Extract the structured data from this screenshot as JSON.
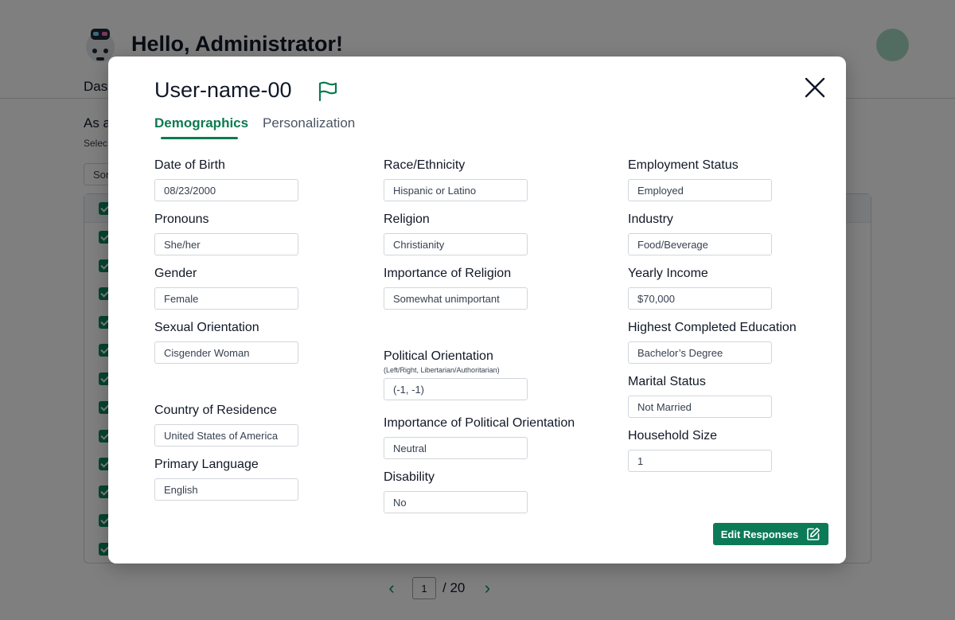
{
  "background": {
    "greeting": "Hello, Administrator!",
    "nav_label": "Dash",
    "heading": "As a",
    "subtext": "Selec",
    "sort_label": "Sor",
    "pager": {
      "current_page": "1",
      "total_label": "/ 20"
    }
  },
  "modal": {
    "title": "User-name-00",
    "tabs": [
      {
        "label": "Demographics",
        "active": true
      },
      {
        "label": "Personalization",
        "active": false
      }
    ],
    "fields": {
      "date_of_birth": {
        "label": "Date of Birth",
        "value": "08/23/2000"
      },
      "pronouns": {
        "label": "Pronouns",
        "value": "She/her"
      },
      "gender": {
        "label": "Gender",
        "value": "Female"
      },
      "sexual_orientation": {
        "label": "Sexual Orientation",
        "value": "Cisgender Woman"
      },
      "country_of_residence": {
        "label": "Country of Residence",
        "value": "United States of America"
      },
      "primary_language": {
        "label": "Primary Language",
        "value": "English"
      },
      "race_ethnicity": {
        "label": "Race/Ethnicity",
        "value": "Hispanic or Latino"
      },
      "religion": {
        "label": "Religion",
        "value": "Christianity"
      },
      "importance_of_religion": {
        "label": "Importance of Religion",
        "value": "Somewhat unimportant"
      },
      "political_orientation": {
        "label": "Political Orientation",
        "hint": "(Left/Right, Libertarian/Authoritarian)",
        "value": "(-1, -1)"
      },
      "importance_of_political_orientation": {
        "label": "Importance of Political Orientation",
        "value": "Neutral"
      },
      "disability": {
        "label": "Disability",
        "value": "No"
      },
      "employment_status": {
        "label": "Employment Status",
        "value": "Employed"
      },
      "industry": {
        "label": "Industry",
        "value": "Food/Beverage"
      },
      "yearly_income": {
        "label": "Yearly Income",
        "value": "$70,000"
      },
      "highest_completed_education": {
        "label": "Highest Completed Education",
        "value": "Bachelor’s Degree"
      },
      "marital_status": {
        "label": "Marital Status",
        "value": "Not Married"
      },
      "household_size": {
        "label": "Household Size",
        "value": "1"
      }
    },
    "edit_button_label": "Edit Responses",
    "icons": {
      "flag": "flag-icon",
      "close": "close-icon",
      "edit": "edit-icon"
    }
  },
  "colors": {
    "accent": "#0d7a50",
    "button": "#0d7a57",
    "checkbox": "#0d8a5e",
    "avatar": "#a7d9c4"
  }
}
